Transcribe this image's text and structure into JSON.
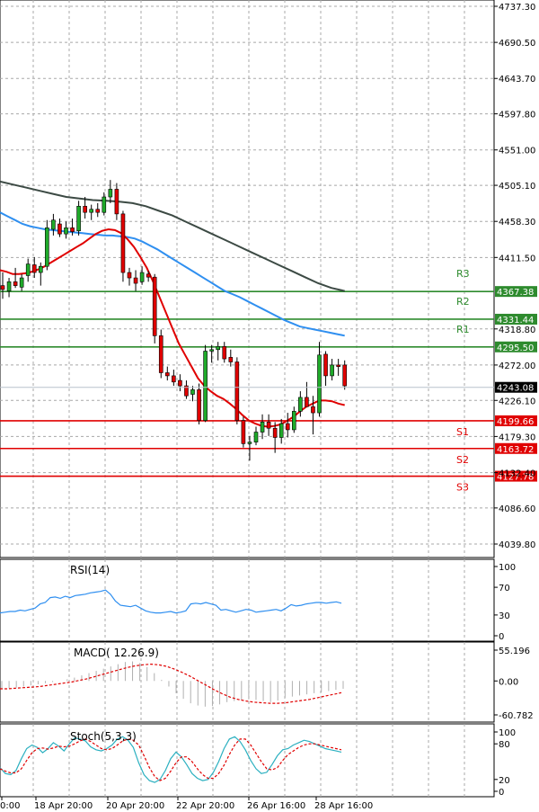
{
  "chart_data": {
    "type": "candlestick",
    "instrument_panel": {
      "y_ticks": [
        "4737.30",
        "4690.50",
        "4643.70",
        "4597.80",
        "4551.00",
        "4505.10",
        "4458.30",
        "4411.50",
        "4318.80",
        "4272.00",
        "4226.10",
        "4179.30",
        "4132.40",
        "4086.60",
        "4039.80"
      ],
      "y_range": [
        4030,
        4745
      ],
      "current_price": "4243.08",
      "levels": [
        {
          "name": "R3",
          "value": 4367.38,
          "label": "4367.38",
          "color": "#2e8b2e"
        },
        {
          "name": "R2",
          "value": 4331.44,
          "label": "4331.44",
          "color": "#2e8b2e"
        },
        {
          "name": "R1",
          "value": 4295.5,
          "label": "4295.50",
          "color": "#2e8b2e"
        },
        {
          "name": "S1",
          "value": 4199.66,
          "label": "4199.66",
          "color": "#e00000"
        },
        {
          "name": "S2",
          "value": 4163.72,
          "label": "4163.72",
          "color": "#e00000"
        },
        {
          "name": "S3",
          "value": 4127.78,
          "label": "4127.78",
          "color": "#e00000"
        }
      ],
      "candles": [
        {
          "o": 4375,
          "h": 4392,
          "l": 4358,
          "c": 4370
        },
        {
          "o": 4368,
          "h": 4385,
          "l": 4360,
          "c": 4380
        },
        {
          "o": 4380,
          "h": 4398,
          "l": 4372,
          "c": 4375
        },
        {
          "o": 4373,
          "h": 4390,
          "l": 4368,
          "c": 4385
        },
        {
          "o": 4388,
          "h": 4410,
          "l": 4380,
          "c": 4403
        },
        {
          "o": 4402,
          "h": 4412,
          "l": 4385,
          "c": 4392
        },
        {
          "o": 4392,
          "h": 4405,
          "l": 4375,
          "c": 4400
        },
        {
          "o": 4400,
          "h": 4460,
          "l": 4395,
          "c": 4450
        },
        {
          "o": 4448,
          "h": 4468,
          "l": 4440,
          "c": 4460
        },
        {
          "o": 4455,
          "h": 4462,
          "l": 4438,
          "c": 4442
        },
        {
          "o": 4442,
          "h": 4458,
          "l": 4436,
          "c": 4450
        },
        {
          "o": 4450,
          "h": 4462,
          "l": 4440,
          "c": 4445
        },
        {
          "o": 4446,
          "h": 4485,
          "l": 4440,
          "c": 4478
        },
        {
          "o": 4478,
          "h": 4490,
          "l": 4462,
          "c": 4470
        },
        {
          "o": 4470,
          "h": 4480,
          "l": 4460,
          "c": 4474
        },
        {
          "o": 4474,
          "h": 4482,
          "l": 4464,
          "c": 4470
        },
        {
          "o": 4470,
          "h": 4496,
          "l": 4466,
          "c": 4490
        },
        {
          "o": 4490,
          "h": 4512,
          "l": 4482,
          "c": 4500
        },
        {
          "o": 4500,
          "h": 4508,
          "l": 4460,
          "c": 4468
        },
        {
          "o": 4468,
          "h": 4472,
          "l": 4380,
          "c": 4392
        },
        {
          "o": 4392,
          "h": 4398,
          "l": 4375,
          "c": 4385
        },
        {
          "o": 4385,
          "h": 4395,
          "l": 4368,
          "c": 4378
        },
        {
          "o": 4380,
          "h": 4400,
          "l": 4376,
          "c": 4392
        },
        {
          "o": 4390,
          "h": 4394,
          "l": 4380,
          "c": 4386
        },
        {
          "o": 4386,
          "h": 4390,
          "l": 4300,
          "c": 4310
        },
        {
          "o": 4310,
          "h": 4318,
          "l": 4255,
          "c": 4262
        },
        {
          "o": 4262,
          "h": 4270,
          "l": 4252,
          "c": 4258
        },
        {
          "o": 4258,
          "h": 4266,
          "l": 4245,
          "c": 4250
        },
        {
          "o": 4252,
          "h": 4260,
          "l": 4238,
          "c": 4245
        },
        {
          "o": 4245,
          "h": 4252,
          "l": 4228,
          "c": 4232
        },
        {
          "o": 4234,
          "h": 4245,
          "l": 4225,
          "c": 4240
        },
        {
          "o": 4240,
          "h": 4248,
          "l": 4195,
          "c": 4200
        },
        {
          "o": 4200,
          "h": 4298,
          "l": 4198,
          "c": 4290
        },
        {
          "o": 4290,
          "h": 4298,
          "l": 4275,
          "c": 4292
        },
        {
          "o": 4292,
          "h": 4302,
          "l": 4278,
          "c": 4296
        },
        {
          "o": 4296,
          "h": 4302,
          "l": 4275,
          "c": 4280
        },
        {
          "o": 4282,
          "h": 4292,
          "l": 4270,
          "c": 4276
        },
        {
          "o": 4276,
          "h": 4282,
          "l": 4195,
          "c": 4200
        },
        {
          "o": 4200,
          "h": 4205,
          "l": 4165,
          "c": 4170
        },
        {
          "o": 4170,
          "h": 4180,
          "l": 4148,
          "c": 4172
        },
        {
          "o": 4172,
          "h": 4192,
          "l": 4168,
          "c": 4185
        },
        {
          "o": 4185,
          "h": 4208,
          "l": 4176,
          "c": 4198
        },
        {
          "o": 4198,
          "h": 4208,
          "l": 4180,
          "c": 4190
        },
        {
          "o": 4190,
          "h": 4198,
          "l": 4158,
          "c": 4178
        },
        {
          "o": 4178,
          "h": 4202,
          "l": 4170,
          "c": 4196
        },
        {
          "o": 4196,
          "h": 4210,
          "l": 4178,
          "c": 4188
        },
        {
          "o": 4188,
          "h": 4218,
          "l": 4184,
          "c": 4212
        },
        {
          "o": 4212,
          "h": 4238,
          "l": 4205,
          "c": 4230
        },
        {
          "o": 4230,
          "h": 4250,
          "l": 4220,
          "c": 4218
        },
        {
          "o": 4218,
          "h": 4232,
          "l": 4182,
          "c": 4210
        },
        {
          "o": 4210,
          "h": 4302,
          "l": 4205,
          "c": 4285
        },
        {
          "o": 4286,
          "h": 4290,
          "l": 4245,
          "c": 4258
        },
        {
          "o": 4258,
          "h": 4280,
          "l": 4252,
          "c": 4272
        },
        {
          "o": 4272,
          "h": 4280,
          "l": 4258,
          "c": 4270
        },
        {
          "o": 4272,
          "h": 4278,
          "l": 4240,
          "c": 4245
        }
      ],
      "ma_fast": [
        4395,
        4393,
        4390,
        4390,
        4391,
        4393,
        4396,
        4400,
        4405,
        4410,
        4415,
        4420,
        4425,
        4430,
        4436,
        4442,
        4446,
        4448,
        4447,
        4443,
        4435,
        4425,
        4412,
        4398,
        4380,
        4360,
        4340,
        4320,
        4300,
        4285,
        4270,
        4255,
        4245,
        4238,
        4232,
        4228,
        4222,
        4215,
        4207,
        4200,
        4196,
        4193,
        4192,
        4193,
        4195,
        4200,
        4205,
        4212,
        4218,
        4222,
        4226,
        4226,
        4225,
        4222,
        4220
      ],
      "ma_mid": [
        4470,
        4465,
        4460,
        4455,
        4452,
        4450,
        4448,
        4447,
        4446,
        4445,
        4444,
        4443,
        4442,
        4441,
        4440,
        4440,
        4439,
        4438,
        4436,
        4432,
        4427,
        4422,
        4416,
        4410,
        4404,
        4398,
        4392,
        4386,
        4380,
        4374,
        4368,
        4364,
        4360,
        4355,
        4350,
        4345,
        4340,
        4335,
        4330,
        4326,
        4322,
        4320,
        4318,
        4316,
        4314,
        4312,
        4310
      ],
      "ma_slow": [
        4510,
        4506,
        4502,
        4498,
        4494,
        4490,
        4488,
        4486,
        4485,
        4484,
        4482,
        4478,
        4472,
        4466,
        4458,
        4450,
        4442,
        4434,
        4426,
        4418,
        4410,
        4402,
        4394,
        4386,
        4378,
        4372,
        4368
      ],
      "ma_colors": [
        "#e00000",
        "#2f8ff0",
        "#3c4a44"
      ]
    },
    "rsi": {
      "title": "RSI(14)",
      "y_ticks": [
        "100",
        "70",
        "30",
        "0"
      ],
      "values": [
        33,
        34,
        35,
        35,
        37,
        36,
        38,
        40,
        46,
        48,
        55,
        56,
        54,
        57,
        55,
        58,
        59,
        60,
        62,
        63,
        64,
        66,
        60,
        50,
        44,
        43,
        42,
        44,
        40,
        36,
        34,
        33,
        33,
        34,
        35,
        33,
        34,
        36,
        46,
        47,
        46,
        48,
        46,
        44,
        37,
        38,
        36,
        34,
        36,
        38,
        37,
        34,
        35,
        36,
        37,
        38,
        36,
        40,
        45,
        43,
        44,
        46,
        47,
        48,
        48,
        47,
        48,
        49,
        47
      ],
      "range": [
        0,
        100
      ]
    },
    "macd": {
      "title": "MACD( 12.26.9)",
      "y_ticks": [
        "55.196",
        "0.00",
        "-60.782"
      ],
      "histogram": [
        -15,
        -13,
        -12,
        -10,
        -8,
        -6,
        -4,
        -2,
        0,
        3,
        6,
        10,
        14,
        18,
        22,
        26,
        30,
        34,
        35,
        32,
        25,
        14,
        2,
        -10,
        -22,
        -32,
        -40,
        -44,
        -46,
        -45,
        -42,
        -38,
        -36,
        -34,
        -33,
        -34,
        -36,
        -38,
        -35,
        -30,
        -28,
        -26,
        -24,
        -22,
        -20,
        -18,
        -16,
        -14
      ],
      "signal": [
        -14,
        -14,
        -13,
        -12,
        -11,
        -10,
        -8,
        -6,
        -4,
        -2,
        1,
        4,
        8,
        12,
        16,
        20,
        24,
        27,
        29,
        30,
        29,
        26,
        21,
        15,
        8,
        0,
        -8,
        -16,
        -23,
        -29,
        -33,
        -36,
        -38,
        -39,
        -40,
        -40,
        -39,
        -37,
        -35,
        -33,
        -30,
        -27,
        -24,
        -21
      ],
      "range": [
        -66,
        62
      ]
    },
    "stoch": {
      "title": "Stoch(5,3,3)",
      "y_ticks": [
        "100",
        "80",
        "20",
        "0"
      ],
      "main": [
        40,
        30,
        28,
        35,
        55,
        72,
        78,
        74,
        65,
        72,
        82,
        76,
        68,
        80,
        90,
        88,
        85,
        75,
        70,
        68,
        72,
        78,
        88,
        92,
        86,
        74,
        48,
        28,
        18,
        15,
        20,
        35,
        55,
        66,
        58,
        45,
        30,
        22,
        18,
        20,
        32,
        50,
        72,
        88,
        92,
        84,
        70,
        52,
        38,
        30,
        32,
        45,
        60,
        70,
        72,
        78,
        82,
        86,
        84,
        80,
        76,
        72,
        70,
        68,
        66
      ],
      "signal": [
        38,
        34,
        31,
        31,
        38,
        52,
        65,
        72,
        73,
        71,
        73,
        76,
        75,
        76,
        80,
        85,
        88,
        84,
        78,
        72,
        70,
        72,
        78,
        85,
        88,
        86,
        78,
        60,
        40,
        25,
        18,
        22,
        34,
        48,
        58,
        58,
        50,
        38,
        28,
        22,
        22,
        30,
        44,
        62,
        78,
        88,
        88,
        78,
        64,
        50,
        38,
        36,
        40,
        52,
        62,
        68,
        74,
        78,
        80,
        80,
        78,
        76,
        74,
        72,
        70
      ],
      "range": [
        0,
        100
      ]
    },
    "x_labels": [
      "0:00",
      "18 Apr 20:00",
      "20 Apr 20:00",
      "22 Apr 20:00",
      "26 Apr 16:00",
      "28 Apr 16:00"
    ],
    "grid": true
  }
}
